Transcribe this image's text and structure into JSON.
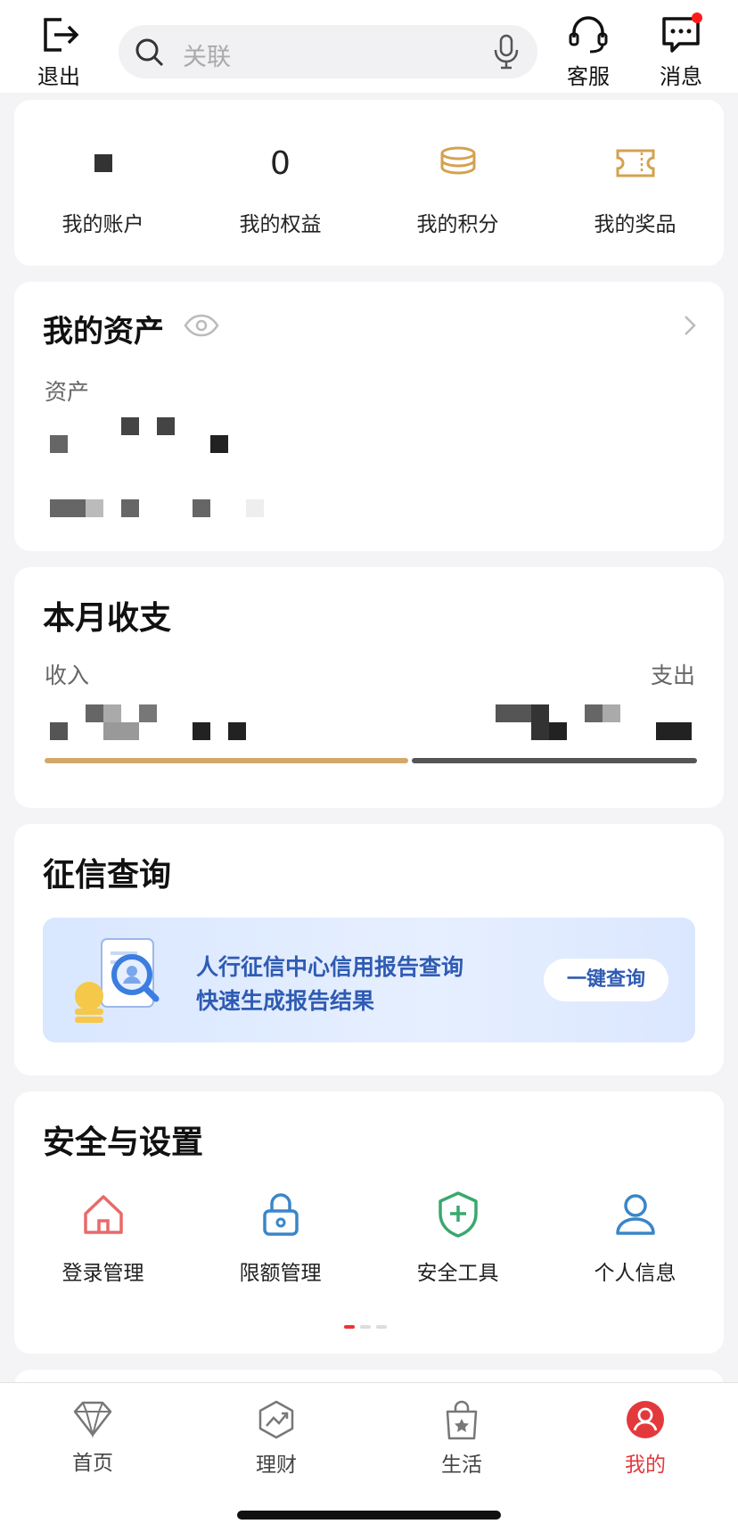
{
  "header": {
    "logout_label": "退出",
    "search_placeholder": "关联",
    "service_label": "客服",
    "message_label": "消息",
    "accent": "#e4393c"
  },
  "quick": {
    "items": [
      {
        "label": "我的账户",
        "value": ""
      },
      {
        "label": "我的权益",
        "value": "0"
      },
      {
        "label": "我的积分",
        "value": ""
      },
      {
        "label": "我的奖品",
        "value": ""
      }
    ]
  },
  "assets": {
    "title": "我的资产",
    "subtitle": "资产"
  },
  "income": {
    "title": "本月收支",
    "income_label": "收入",
    "expense_label": "支出"
  },
  "credit": {
    "title": "征信查询",
    "line1": "人行征信中心信用报告查询",
    "line2": "快速生成报告结果",
    "button": "一键查询"
  },
  "security": {
    "title": "安全与设置",
    "items": [
      {
        "label": "登录管理",
        "icon": "home-icon",
        "color": "#e86a6a"
      },
      {
        "label": "限额管理",
        "icon": "lock-icon",
        "color": "#3a86c8"
      },
      {
        "label": "安全工具",
        "icon": "shield-plus-icon",
        "color": "#3aa86e"
      },
      {
        "label": "个人信息",
        "icon": "person-icon",
        "color": "#3a86c8"
      }
    ]
  },
  "tabs": [
    {
      "label": "首页",
      "icon": "diamond-icon"
    },
    {
      "label": "理财",
      "icon": "chart-icon"
    },
    {
      "label": "生活",
      "icon": "bag-icon"
    },
    {
      "label": "我的",
      "icon": "user-icon",
      "active": true
    }
  ]
}
